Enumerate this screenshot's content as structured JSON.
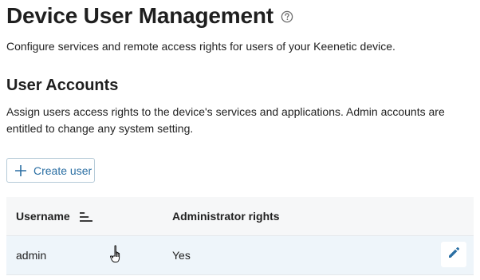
{
  "header": {
    "title": "Device User Management",
    "description": "Configure services and remote access rights for users of your Keenetic device."
  },
  "user_accounts": {
    "title": "User Accounts",
    "description": "Assign users access rights to the device's services and applications. Admin accounts are entitled to change any system setting.",
    "create_button_label": "Create user",
    "table": {
      "columns": [
        "Username",
        "Administrator rights"
      ],
      "rows": [
        {
          "username": "admin",
          "admin_rights": "Yes"
        }
      ]
    }
  },
  "icons": {
    "help": "help-circle-icon",
    "create": "plus-icon",
    "sort": "sort-icon",
    "edit": "pencil-icon",
    "cursor": "hand-cursor-icon"
  },
  "colors": {
    "accent": "#2b6fa3",
    "row_highlight": "#eef5fa",
    "header_bg": "#f6f7f8"
  }
}
